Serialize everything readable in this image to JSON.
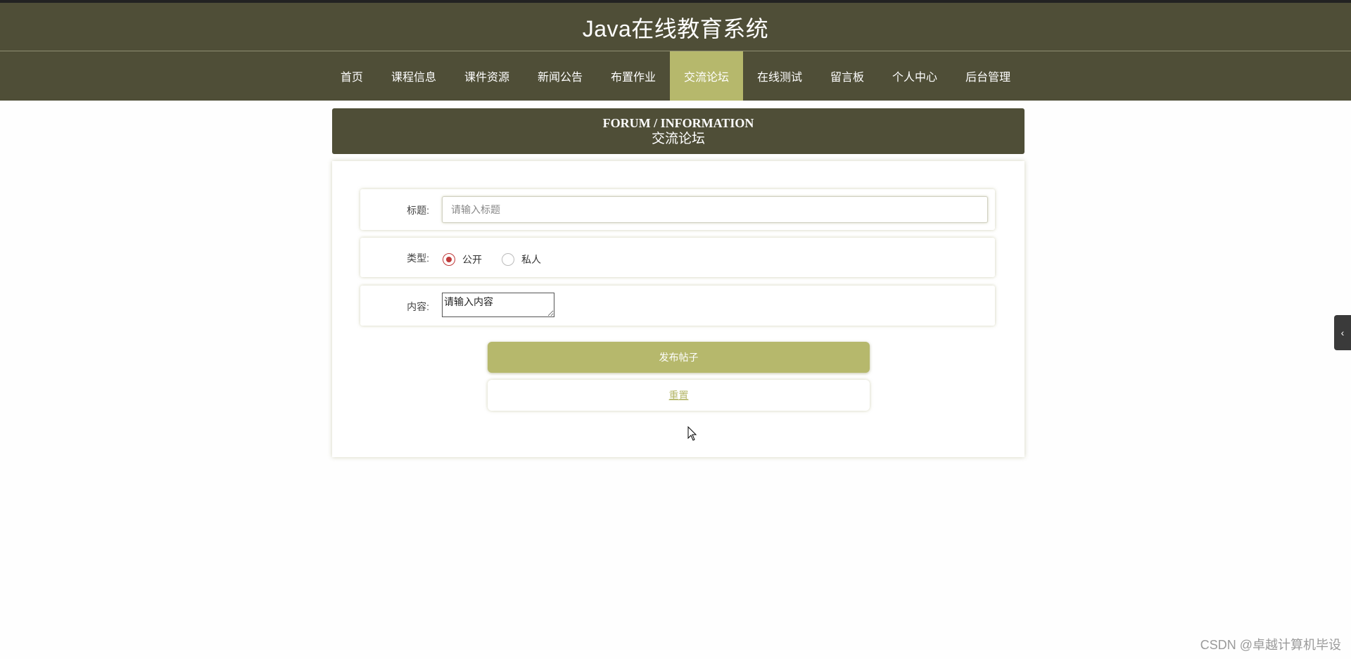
{
  "header": {
    "title": "Java在线教育系统"
  },
  "nav": {
    "items": [
      {
        "label": "首页",
        "active": false
      },
      {
        "label": "课程信息",
        "active": false
      },
      {
        "label": "课件资源",
        "active": false
      },
      {
        "label": "新闻公告",
        "active": false
      },
      {
        "label": "布置作业",
        "active": false
      },
      {
        "label": "交流论坛",
        "active": true
      },
      {
        "label": "在线测试",
        "active": false
      },
      {
        "label": "留言板",
        "active": false
      },
      {
        "label": "个人中心",
        "active": false
      },
      {
        "label": "后台管理",
        "active": false
      }
    ]
  },
  "banner": {
    "title_en": "FORUM / INFORMATION",
    "title_cn": "交流论坛"
  },
  "form": {
    "title_label": "标题:",
    "title_placeholder": "请输入标题",
    "title_value": "",
    "type_label": "类型:",
    "type_options": [
      {
        "label": "公开",
        "checked": true
      },
      {
        "label": "私人",
        "checked": false
      }
    ],
    "content_label": "内容:",
    "content_placeholder": "请输入内容",
    "submit_label": "发布帖子",
    "reset_label": "重置"
  },
  "side_toggle": {
    "icon": "chevron-left-icon",
    "glyph": "‹"
  },
  "watermark": "CSDN @卓越计算机毕设",
  "colors": {
    "header_bg": "#4f4e37",
    "accent": "#b6b86c",
    "radio_checked": "#c03a3a"
  }
}
